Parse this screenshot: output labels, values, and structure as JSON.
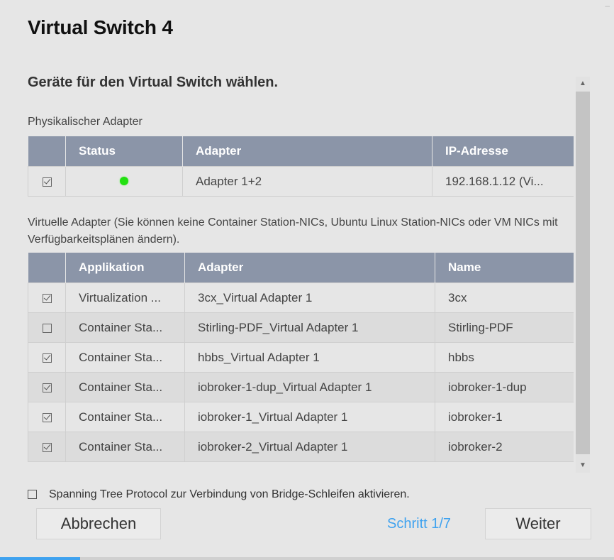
{
  "window": {
    "title": "Virtual Switch 4"
  },
  "heading": "Geräte für den Virtual Switch wählen.",
  "physical": {
    "label": "Physikalischer Adapter",
    "columns": [
      "",
      "Status",
      "Adapter",
      "IP-Adresse"
    ],
    "rows": [
      {
        "checked": true,
        "status": "online",
        "adapter": "Adapter 1+2",
        "ip": "192.168.1.12 (Vi..."
      }
    ]
  },
  "virtual": {
    "description": "Virtuelle Adapter (Sie können keine Container Station-NICs, Ubuntu Linux Station-NICs oder VM NICs mit Verfügbarkeitsplänen ändern).",
    "columns": [
      "",
      "Applikation",
      "Adapter",
      "Name"
    ],
    "rows": [
      {
        "checked": true,
        "app": "Virtualization ...",
        "adapter": "3cx_Virtual Adapter 1",
        "name": "3cx"
      },
      {
        "checked": false,
        "app": "Container Sta...",
        "adapter": "Stirling-PDF_Virtual Adapter 1",
        "name": "Stirling-PDF"
      },
      {
        "checked": true,
        "app": "Container Sta...",
        "adapter": "hbbs_Virtual Adapter 1",
        "name": "hbbs"
      },
      {
        "checked": true,
        "app": "Container Sta...",
        "adapter": "iobroker-1-dup_Virtual Adapter 1",
        "name": "iobroker-1-dup"
      },
      {
        "checked": true,
        "app": "Container Sta...",
        "adapter": "iobroker-1_Virtual Adapter 1",
        "name": "iobroker-1"
      },
      {
        "checked": true,
        "app": "Container Sta...",
        "adapter": "iobroker-2_Virtual Adapter 1",
        "name": "iobroker-2"
      }
    ]
  },
  "stp": {
    "checked": false,
    "label": "Spanning Tree Protocol zur Verbindung von Bridge-Schleifen aktivieren."
  },
  "footer": {
    "cancel_label": "Abbrechen",
    "step_label": "Schritt 1/7",
    "next_label": "Weiter",
    "progress": 0.13
  },
  "colors": {
    "header": "#8b95a8",
    "accent": "#3fa2ef",
    "status_online": "#22e011"
  }
}
